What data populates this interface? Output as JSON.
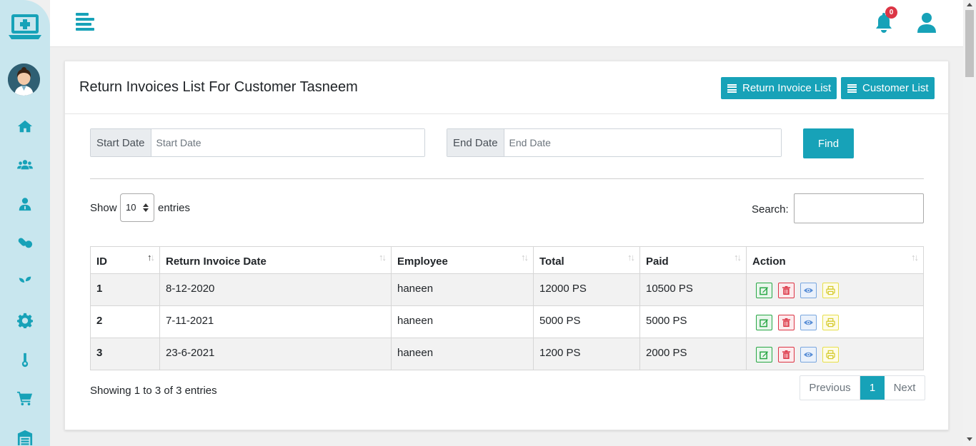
{
  "topbar": {
    "notification_count": "0"
  },
  "page": {
    "title": "Return Invoices List For Customer Tasneem",
    "return_invoice_list_btn": "Return Invoice List",
    "customer_list_btn": "Customer List"
  },
  "filters": {
    "start_label": "Start Date",
    "start_placeholder": "Start Date",
    "end_label": "End Date",
    "end_placeholder": "End Date",
    "find_label": "Find"
  },
  "table_controls": {
    "show_label": "Show",
    "entries_value": "10",
    "entries_label": "entries",
    "search_label": "Search:"
  },
  "table": {
    "columns": [
      "ID",
      "Return Invoice Date",
      "Employee",
      "Total",
      "Paid",
      "Action"
    ],
    "rows": [
      {
        "id": "1",
        "date": "8-12-2020",
        "employee": "haneen",
        "total": "12000 PS",
        "paid": "10500 PS"
      },
      {
        "id": "2",
        "date": "7-11-2021",
        "employee": "haneen",
        "total": "5000 PS",
        "paid": "5000 PS"
      },
      {
        "id": "3",
        "date": "23-6-2021",
        "employee": "haneen",
        "total": "1200 PS",
        "paid": "2000 PS"
      }
    ]
  },
  "footer": {
    "info": "Showing 1 to 3 of 3 entries",
    "previous": "Previous",
    "current_page": "1",
    "next": "Next"
  },
  "colors": {
    "accent": "#17a2b8",
    "sidebar_bg": "#c8e6ee",
    "danger": "#dc3545",
    "success": "#28a745"
  }
}
